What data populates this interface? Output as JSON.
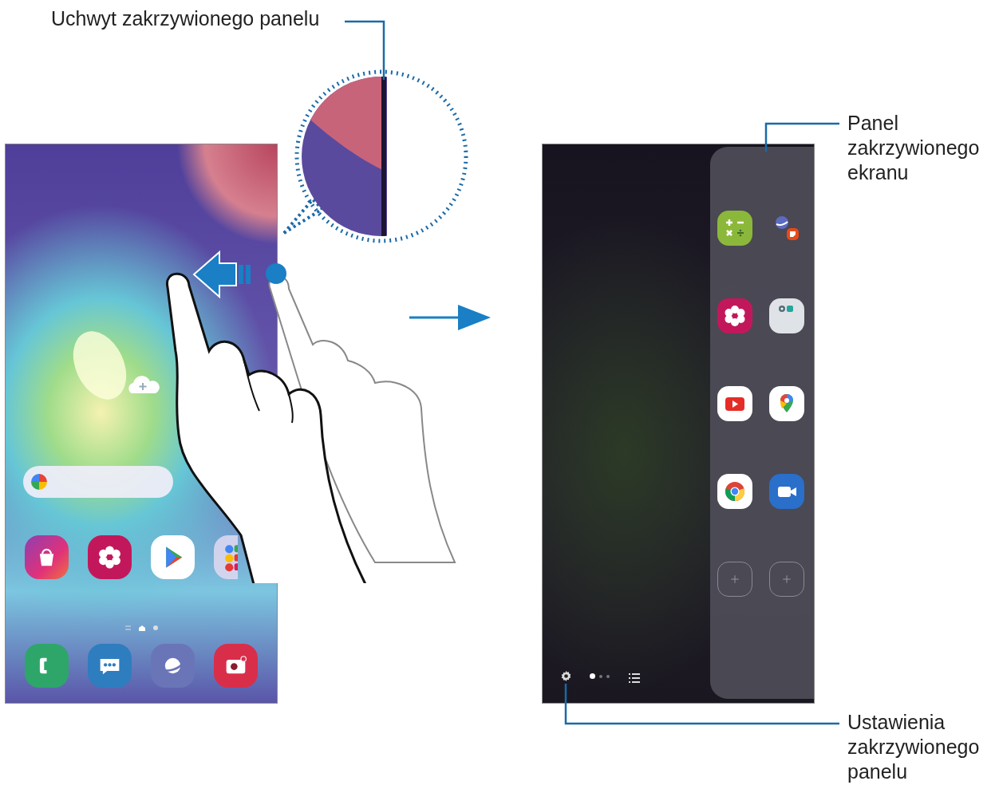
{
  "callouts": [
    {
      "kind": "handle",
      "text": "Uchwyt zakrzywionego panelu"
    },
    {
      "kind": "panel",
      "text": "Panel zakrzywionego ekranu"
    },
    {
      "kind": "settings",
      "text": "Ustawienia zakrzywionego panelu"
    }
  ],
  "edge_panel": {
    "page_dots": [
      {
        "selected": true
      },
      {
        "selected": false
      },
      {
        "selected": false
      }
    ]
  }
}
